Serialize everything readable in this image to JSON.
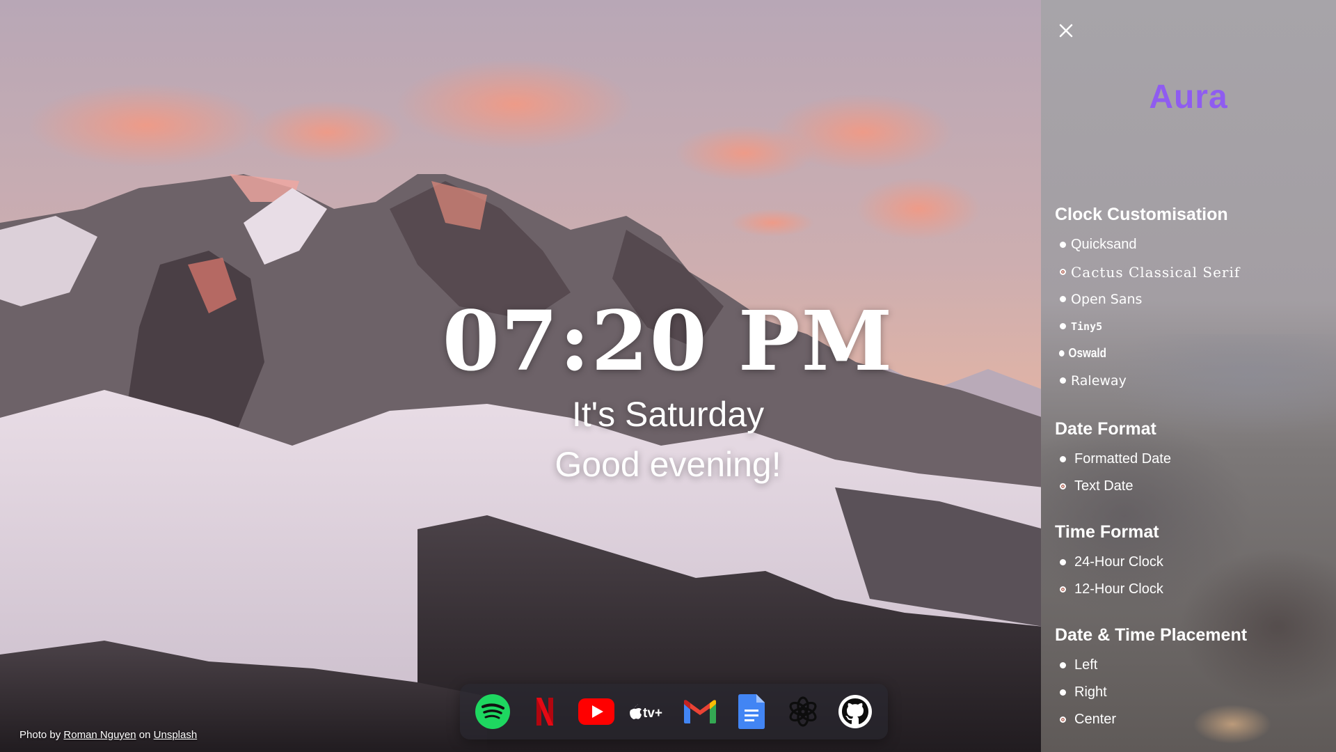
{
  "clock": {
    "time": "07:20 PM",
    "day": "It's Saturday",
    "greeting": "Good evening!"
  },
  "dock": {
    "apps": [
      {
        "name": "Spotify",
        "icon": "spotify-icon",
        "color": "#1ed760"
      },
      {
        "name": "Netflix",
        "icon": "netflix-icon",
        "color": "#e50914"
      },
      {
        "name": "YouTube",
        "icon": "youtube-icon",
        "color": "#ff0000"
      },
      {
        "name": "Apple TV+",
        "icon": "apple-tv-icon",
        "label": "tv+"
      },
      {
        "name": "Gmail",
        "icon": "gmail-icon"
      },
      {
        "name": "Google Docs",
        "icon": "google-docs-icon",
        "color": "#4285f4"
      },
      {
        "name": "ChatGPT",
        "icon": "chatgpt-icon"
      },
      {
        "name": "GitHub",
        "icon": "github-icon"
      }
    ]
  },
  "credit": {
    "prefix": "Photo by",
    "author": "Roman Nguyen",
    "middle": "on",
    "source": "Unsplash"
  },
  "panel": {
    "brand": "Aura",
    "brand_color": "#8f5cf0",
    "sections": {
      "clock": {
        "title": "Clock Customisation",
        "options": [
          "Quicksand",
          "Cactus Classical Serif",
          "Open Sans",
          "Tiny5",
          "Oswald",
          "Raleway"
        ],
        "selected": "Cactus Classical Serif"
      },
      "date": {
        "title": "Date Format",
        "options": [
          "Formatted Date",
          "Text Date"
        ],
        "selected": "Text Date"
      },
      "time": {
        "title": "Time Format",
        "options": [
          "24-Hour Clock",
          "12-Hour Clock"
        ],
        "selected": "12-Hour Clock"
      },
      "placement": {
        "title": "Date & Time Placement",
        "options": [
          "Left",
          "Right",
          "Center"
        ],
        "selected": "Center"
      }
    }
  }
}
